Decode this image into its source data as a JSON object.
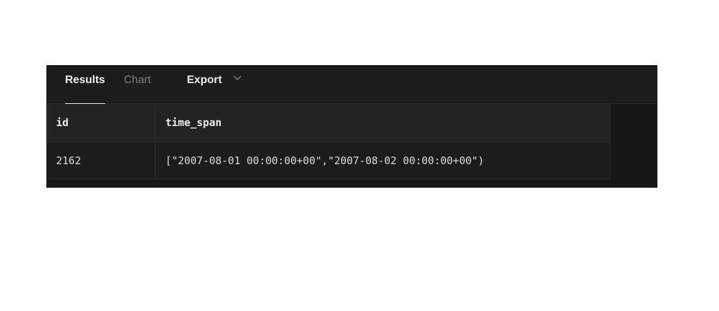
{
  "tabs": {
    "results_label": "Results",
    "chart_label": "Chart"
  },
  "export": {
    "label": "Export",
    "icon": "chevron-down-icon"
  },
  "table": {
    "columns": [
      "id",
      "time_span"
    ],
    "rows": [
      [
        "2162",
        "[\"2007-08-01 00:00:00+00\",\"2007-08-02 00:00:00+00\")"
      ]
    ]
  },
  "colors": {
    "panel_bg": "#171717",
    "header_bg": "#232323",
    "row_bg": "#1c1c1c",
    "text": "#ededed",
    "muted": "#7e7e7e"
  }
}
